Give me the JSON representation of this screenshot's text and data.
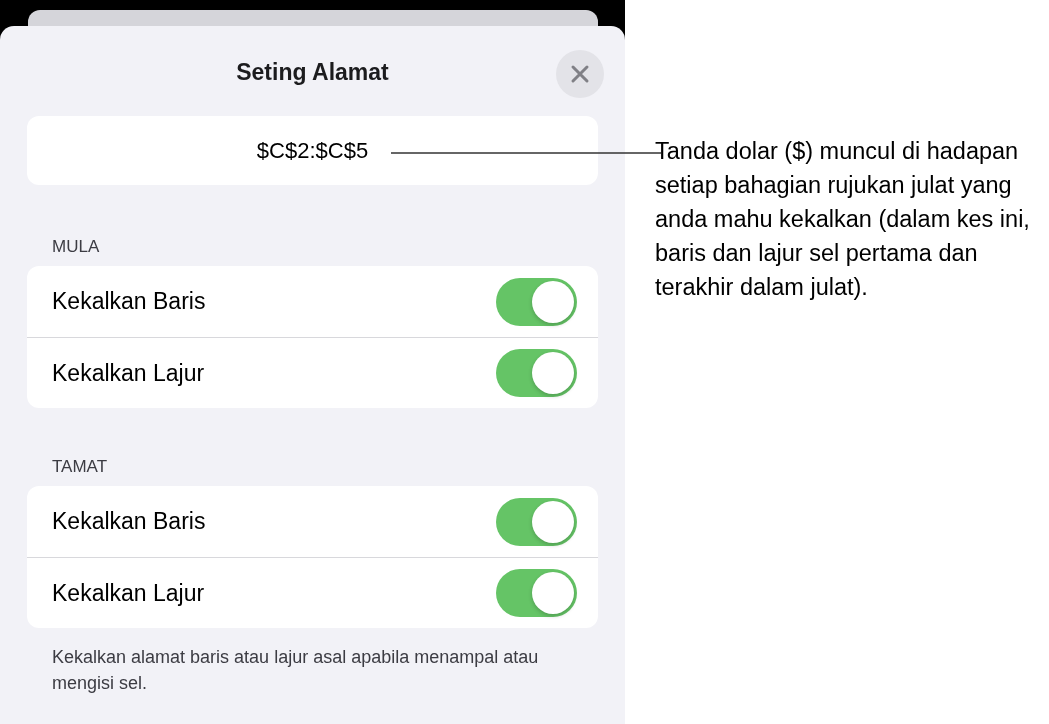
{
  "sheet": {
    "title": "Seting Alamat",
    "address": "$C$2:$C$5",
    "sections": [
      {
        "header": "MULA",
        "rows": [
          {
            "label": "Kekalkan Baris",
            "on": true
          },
          {
            "label": "Kekalkan Lajur",
            "on": true
          }
        ]
      },
      {
        "header": "TAMAT",
        "rows": [
          {
            "label": "Kekalkan Baris",
            "on": true
          },
          {
            "label": "Kekalkan Lajur",
            "on": true
          }
        ]
      }
    ],
    "footnote": "Kekalkan alamat baris atau lajur asal apabila menampal atau mengisi sel."
  },
  "callout": {
    "text": "Tanda dolar ($) muncul di hadapan setiap bahagian rujukan julat yang anda mahu kekalkan (dalam kes ini, baris dan lajur sel pertama dan terakhir dalam julat)."
  }
}
